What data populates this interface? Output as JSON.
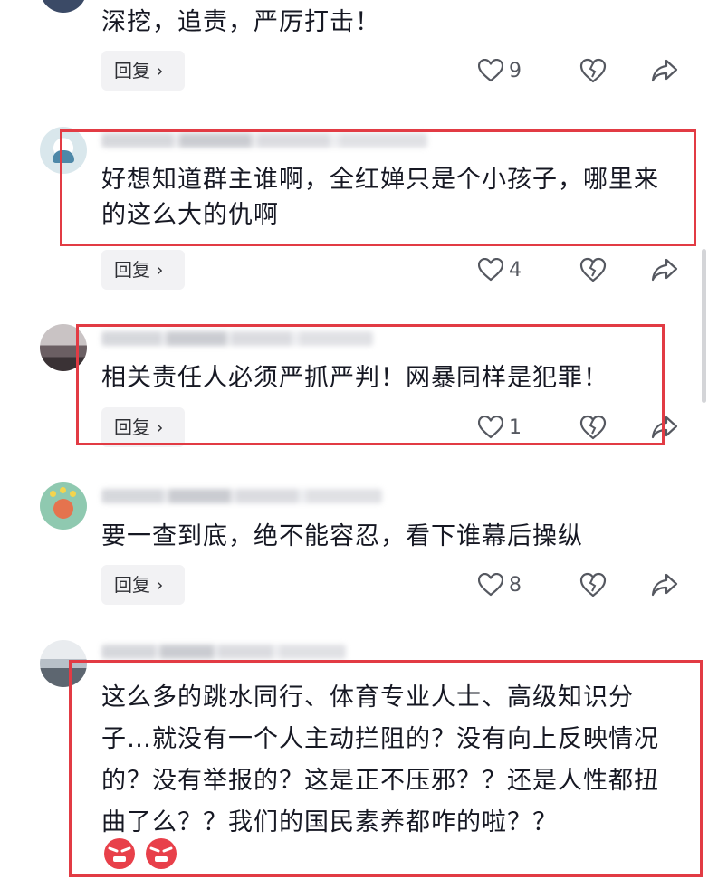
{
  "comments": [
    {
      "text": "深挖，追责，严厉打击！",
      "likes": "9",
      "reply_label": "回复"
    },
    {
      "text": "好想知道群主谁啊，全红婵只是个小孩子，哪里来的这么大的仇啊",
      "likes": "4",
      "reply_label": "回复"
    },
    {
      "text": "相关责任人必须严抓严判！网暴同样是犯罪！",
      "likes": "1",
      "reply_label": "回复"
    },
    {
      "text": "要一查到底，绝不能容忍，看下谁幕后操纵",
      "likes": "8",
      "reply_label": "回复"
    },
    {
      "text": "这么多的跳水同行、体育专业人士、高级知识分子…就没有一个人主动拦阻的？没有向上反映情况的？没有举报的？这是正不压邪？？还是人性都扭曲了么？？我们的国民素养都咋的啦？？",
      "emojis": [
        "angry-emoji",
        "angry-emoji"
      ]
    }
  ],
  "icons": {
    "like": "heart-outline-icon",
    "dislike": "broken-heart-icon",
    "share": "share-arrow-icon",
    "reply_chevron": "chevron-right-icon"
  },
  "colors": {
    "highlight": "#e23b44",
    "text": "#161823",
    "reply_bg": "#f2f2f4"
  }
}
